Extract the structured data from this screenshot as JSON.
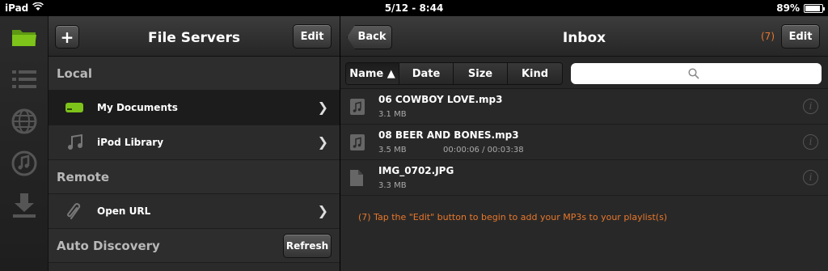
{
  "status": {
    "device": "iPad",
    "time": "5/12 - 8:44",
    "battery": "89%",
    "battery_level": 0.89,
    "icons": [
      "wifi-icon",
      "battery-icon"
    ]
  },
  "rail": {
    "items": [
      {
        "name": "folder-icon",
        "color": "#7dc31a",
        "active": true
      },
      {
        "name": "list-icon",
        "color": "#555555"
      },
      {
        "name": "globe-icon",
        "color": "#555555"
      },
      {
        "name": "music-icon",
        "color": "#555555"
      },
      {
        "name": "download-icon",
        "color": "#555555"
      }
    ]
  },
  "left": {
    "title": "File Servers",
    "add_label": "+",
    "edit_label": "Edit",
    "sections": {
      "local": "Local",
      "remote": "Remote",
      "auto": "Auto Discovery"
    },
    "refresh_label": "Refresh",
    "items": {
      "my_documents": "My Documents",
      "ipod_library": "iPod Library",
      "open_url": "Open URL"
    },
    "chevron": "❯"
  },
  "right": {
    "back_label": "Back",
    "title": "Inbox",
    "count": "(7)",
    "edit_label": "Edit",
    "sort": {
      "name": "Name ▲",
      "date": "Date",
      "size": "Size",
      "kind": "Kind",
      "active": "name"
    },
    "search_placeholder": "",
    "files": [
      {
        "name": "06 COWBOY LOVE.mp3",
        "size": "3.1 MB",
        "time": "",
        "icon": "music-file-icon"
      },
      {
        "name": "08 BEER AND BONES.mp3",
        "size": "3.5 MB",
        "time": "00:00:06 / 00:03:38",
        "icon": "music-file-icon"
      },
      {
        "name": "IMG_0702.JPG",
        "size": "3.3 MB",
        "time": "",
        "icon": "document-icon"
      }
    ],
    "info_glyph": "i",
    "hint": "(7) Tap the \"Edit\" button to begin to add your MP3s to your playlist(s)"
  },
  "colors": {
    "accent_green": "#7dc31a",
    "accent_orange": "#e8772b"
  }
}
